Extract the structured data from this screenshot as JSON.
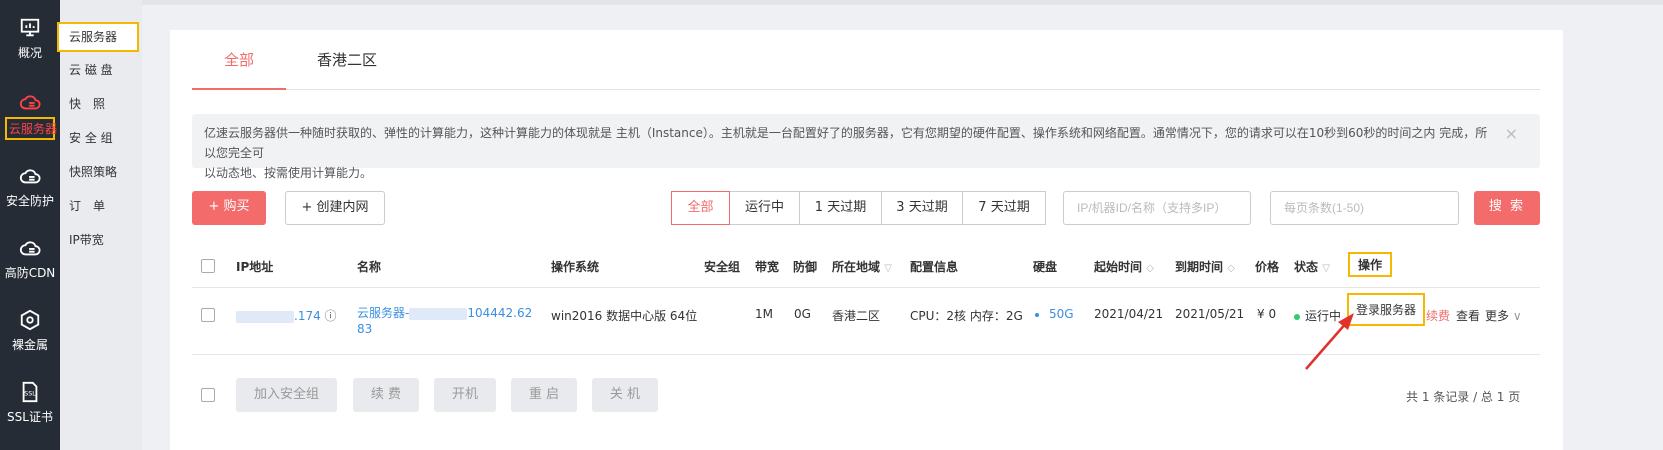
{
  "nav": [
    {
      "label": "概况",
      "icon": "monitor-icon"
    },
    {
      "label": "云服务器",
      "icon": "cloud-server-icon"
    },
    {
      "label": "安全防护",
      "icon": "cloud-shield-icon"
    },
    {
      "label": "高防CDN",
      "icon": "cloud-cdn-icon"
    },
    {
      "label": "裸金属",
      "icon": "baremetal-icon"
    },
    {
      "label": "SSL证书",
      "icon": "ssl-icon"
    }
  ],
  "subnav": [
    "云服务器",
    "云 磁 盘",
    "快　照",
    "安 全 组",
    "快照策略",
    "订　单",
    "IP带宽"
  ],
  "tabs": [
    "全部",
    "香港二区"
  ],
  "notice": {
    "line1": "亿速云服务器供一种随时获取的、弹性的计算能力，这种计算能力的体现就是 主机（Instance）。主机就是一台配置好了的服务器，它有您期望的硬件配置、操作系统和网络配置。通常情况下，您的请求可以在10秒到60秒的时间之内 完成，所以您完全可",
    "line2": "以动态地、按需使用计算能力。",
    "close": "×"
  },
  "toolbar": {
    "buy": "+ 购买",
    "create_net": "+ 创建内网",
    "filters": [
      "全部",
      "运行中",
      "1 天过期",
      "3 天过期",
      "7 天过期"
    ],
    "ip_placeholder": "IP/机器ID/名称（支持多IP）",
    "page_placeholder": "每页条数(1-50)",
    "search": "搜 索"
  },
  "table": {
    "headers": {
      "ip": "IP地址",
      "name": "名称",
      "os": "操作系统",
      "sg": "安全组",
      "bw": "带宽",
      "def": "防御",
      "region": "所在地域",
      "config": "配置信息",
      "disk": "硬盘",
      "start": "起始时间",
      "end": "到期时间",
      "price": "价格",
      "status": "状态",
      "op": "操作"
    },
    "row": {
      "ip": ".174",
      "name_a": "云服务器-",
      "name_b": "104442.62",
      "name_c": "83",
      "os": "win2016 数据中心版 64位",
      "bw": "1M",
      "def": "0G",
      "region": "香港二区",
      "config": "CPU：2核 内存：2G",
      "disk": "50G",
      "start": "2021/04/21",
      "end": "2021/05/21",
      "price": "¥ 0",
      "status": "运行中",
      "login": "登录服务器",
      "renew": "续费",
      "view": "查看",
      "more": "更多"
    }
  },
  "bottom_actions": [
    "加入安全组",
    "续 费",
    "开机",
    "重 启",
    "关 机"
  ],
  "pager": "共 1 条记录 / 总 1 页",
  "colors": {
    "accent": "#f36b6b",
    "highlight": "#f5b800",
    "link": "#3b8fe0",
    "sidebar": "#262c36"
  }
}
